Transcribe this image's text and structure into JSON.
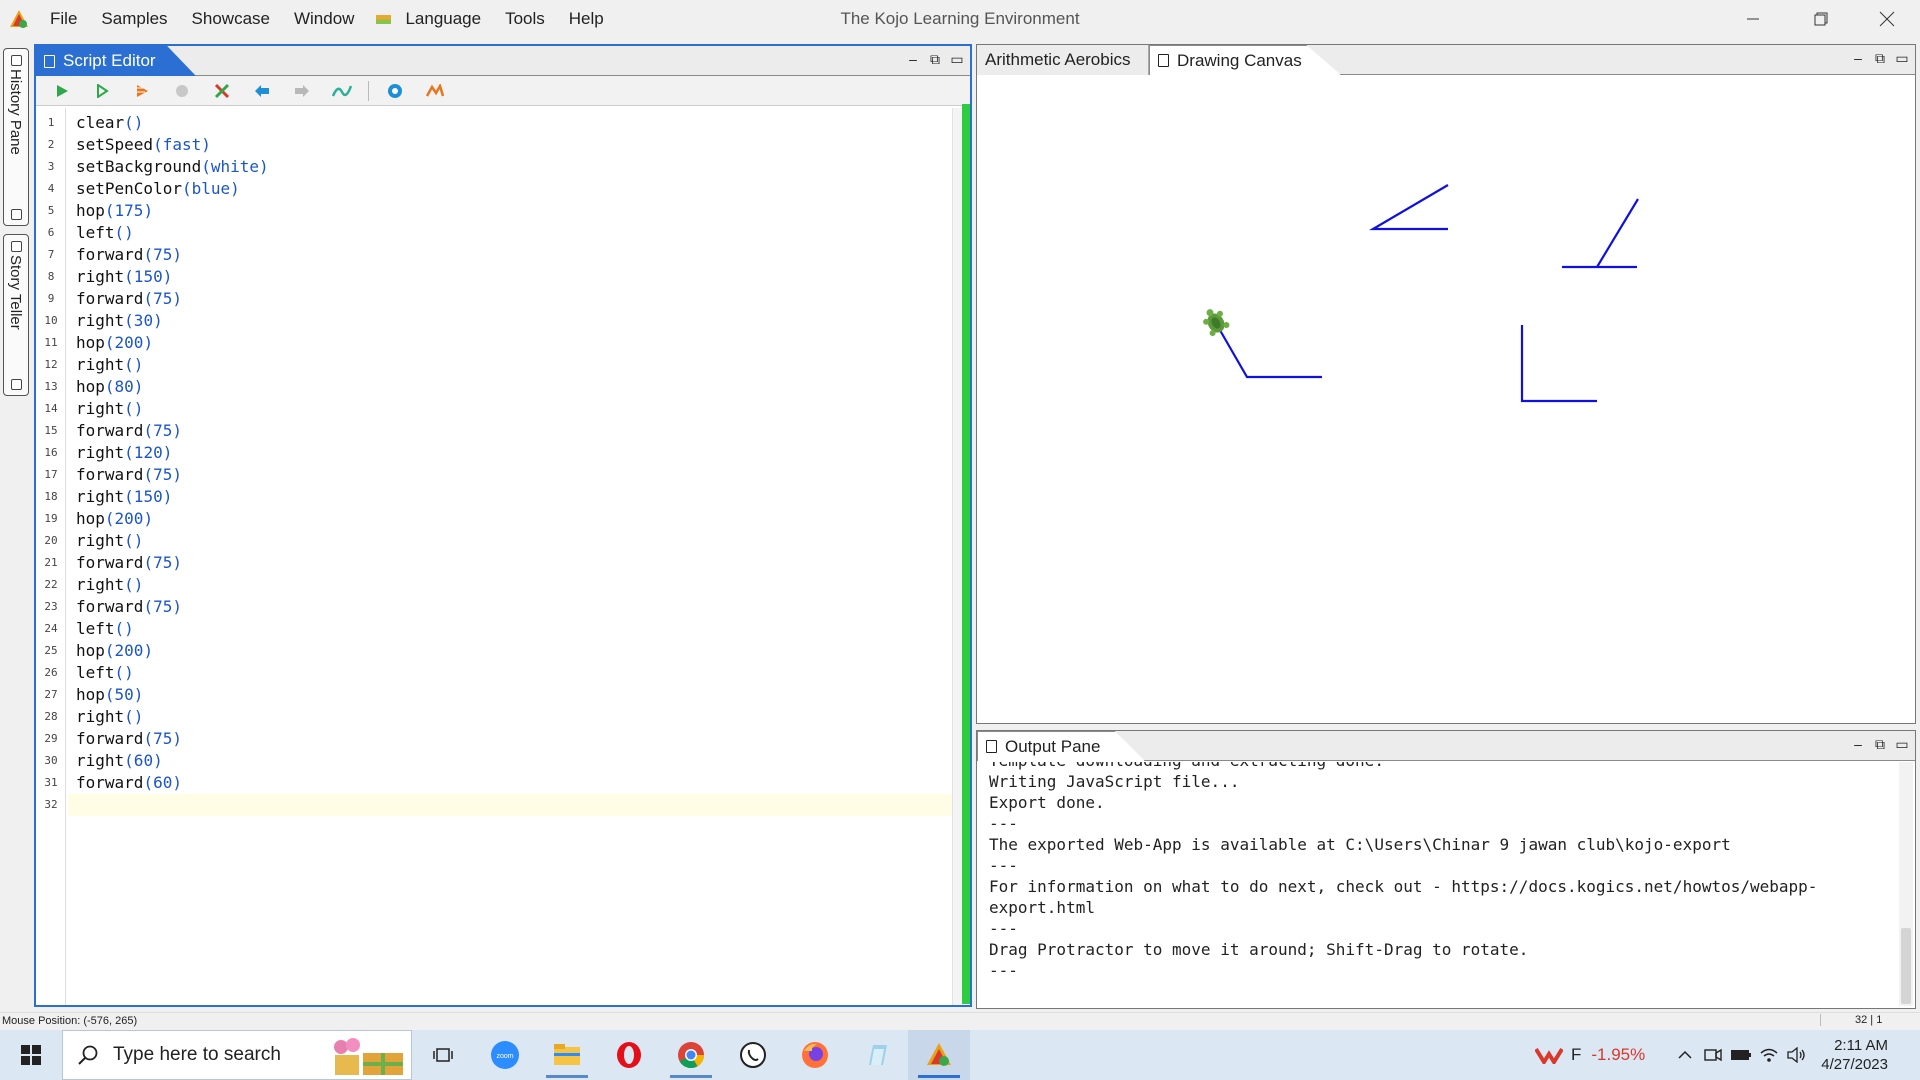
{
  "app": {
    "window_title": "The Kojo Learning Environment",
    "menu": [
      "File",
      "Samples",
      "Showcase",
      "Window",
      "Language",
      "Tools",
      "Help"
    ]
  },
  "side_tabs": {
    "history": "History Pane",
    "story": "Story Teller"
  },
  "editor": {
    "tab_label": "Script Editor",
    "toolbar_buttons": [
      "run-icon",
      "run-worksheet-icon",
      "trace-icon",
      "stop-icon",
      "clear-icon",
      "undo-icon",
      "redo-icon",
      "format-icon",
      "help-icon",
      "kojo-icon"
    ],
    "lines": [
      {
        "n": "1",
        "fn": "clear",
        "arg": "()"
      },
      {
        "n": "2",
        "fn": "setSpeed",
        "arg": "(fast)"
      },
      {
        "n": "3",
        "fn": "setBackground",
        "arg": "(white)"
      },
      {
        "n": "4",
        "fn": "setPenColor",
        "arg": "(blue)"
      },
      {
        "n": "5",
        "fn": "hop",
        "arg": "(175)"
      },
      {
        "n": "6",
        "fn": "left",
        "arg": "()"
      },
      {
        "n": "7",
        "fn": "forward",
        "arg": "(75)"
      },
      {
        "n": "8",
        "fn": "right",
        "arg": "(150)"
      },
      {
        "n": "9",
        "fn": "forward",
        "arg": "(75)"
      },
      {
        "n": "10",
        "fn": "right",
        "arg": "(30)"
      },
      {
        "n": "11",
        "fn": "hop",
        "arg": "(200)"
      },
      {
        "n": "12",
        "fn": "right",
        "arg": "()"
      },
      {
        "n": "13",
        "fn": "hop",
        "arg": "(80)"
      },
      {
        "n": "14",
        "fn": "right",
        "arg": "()"
      },
      {
        "n": "15",
        "fn": "forward",
        "arg": "(75)"
      },
      {
        "n": "16",
        "fn": "right",
        "arg": "(120)"
      },
      {
        "n": "17",
        "fn": "forward",
        "arg": "(75)"
      },
      {
        "n": "18",
        "fn": "right",
        "arg": "(150)"
      },
      {
        "n": "19",
        "fn": "hop",
        "arg": "(200)"
      },
      {
        "n": "20",
        "fn": "right",
        "arg": "()"
      },
      {
        "n": "21",
        "fn": "forward",
        "arg": "(75)"
      },
      {
        "n": "22",
        "fn": "right",
        "arg": "()"
      },
      {
        "n": "23",
        "fn": "forward",
        "arg": "(75)"
      },
      {
        "n": "24",
        "fn": "left",
        "arg": "()"
      },
      {
        "n": "25",
        "fn": "hop",
        "arg": "(200)"
      },
      {
        "n": "26",
        "fn": "left",
        "arg": "()"
      },
      {
        "n": "27",
        "fn": "hop",
        "arg": "(50)"
      },
      {
        "n": "28",
        "fn": "right",
        "arg": "()"
      },
      {
        "n": "29",
        "fn": "forward",
        "arg": "(75)"
      },
      {
        "n": "30",
        "fn": "right",
        "arg": "(60)"
      },
      {
        "n": "31",
        "fn": "forward",
        "arg": "(60)"
      },
      {
        "n": "32",
        "fn": "",
        "arg": ""
      }
    ]
  },
  "canvas": {
    "tabs": [
      "Arithmetic Aerobics",
      "Drawing Canvas"
    ],
    "active_tab": "Drawing Canvas",
    "pen_color": "#1010e0",
    "turtle": "turtle-icon"
  },
  "output": {
    "tab_label": "Output Pane",
    "lines": [
      "Template downloading and extracting done.",
      "Writing JavaScript file...",
      "Export done.",
      "---",
      "The exported Web-App is available at C:\\Users\\Chinar 9 jawan club\\kojo-export",
      "---",
      "For information on what to do next, check out - https://docs.kogics.net/howtos/webapp-export.html",
      "---",
      "Drag Protractor to move it around; Shift-Drag to rotate.",
      "---"
    ]
  },
  "status": {
    "mouse_position": "Mouse Position: (-576, 265)",
    "caret": "32 | 1"
  },
  "taskbar": {
    "search_placeholder": "Type here to search",
    "apps": [
      "task-view-icon",
      "zoom-icon",
      "file-explorer-icon",
      "opera-icon",
      "chrome-icon",
      "whatsapp-icon",
      "firefox-icon",
      "notepad-icon",
      "kojo-icon"
    ],
    "stock_ticker": "F",
    "stock_change": "-1.95%",
    "time": "2:11 AM",
    "date": "4/27/2023"
  },
  "colors": {
    "accent": "#2a6fd1",
    "code_arg": "#1a55c9",
    "stock_down": "#d9382b"
  }
}
